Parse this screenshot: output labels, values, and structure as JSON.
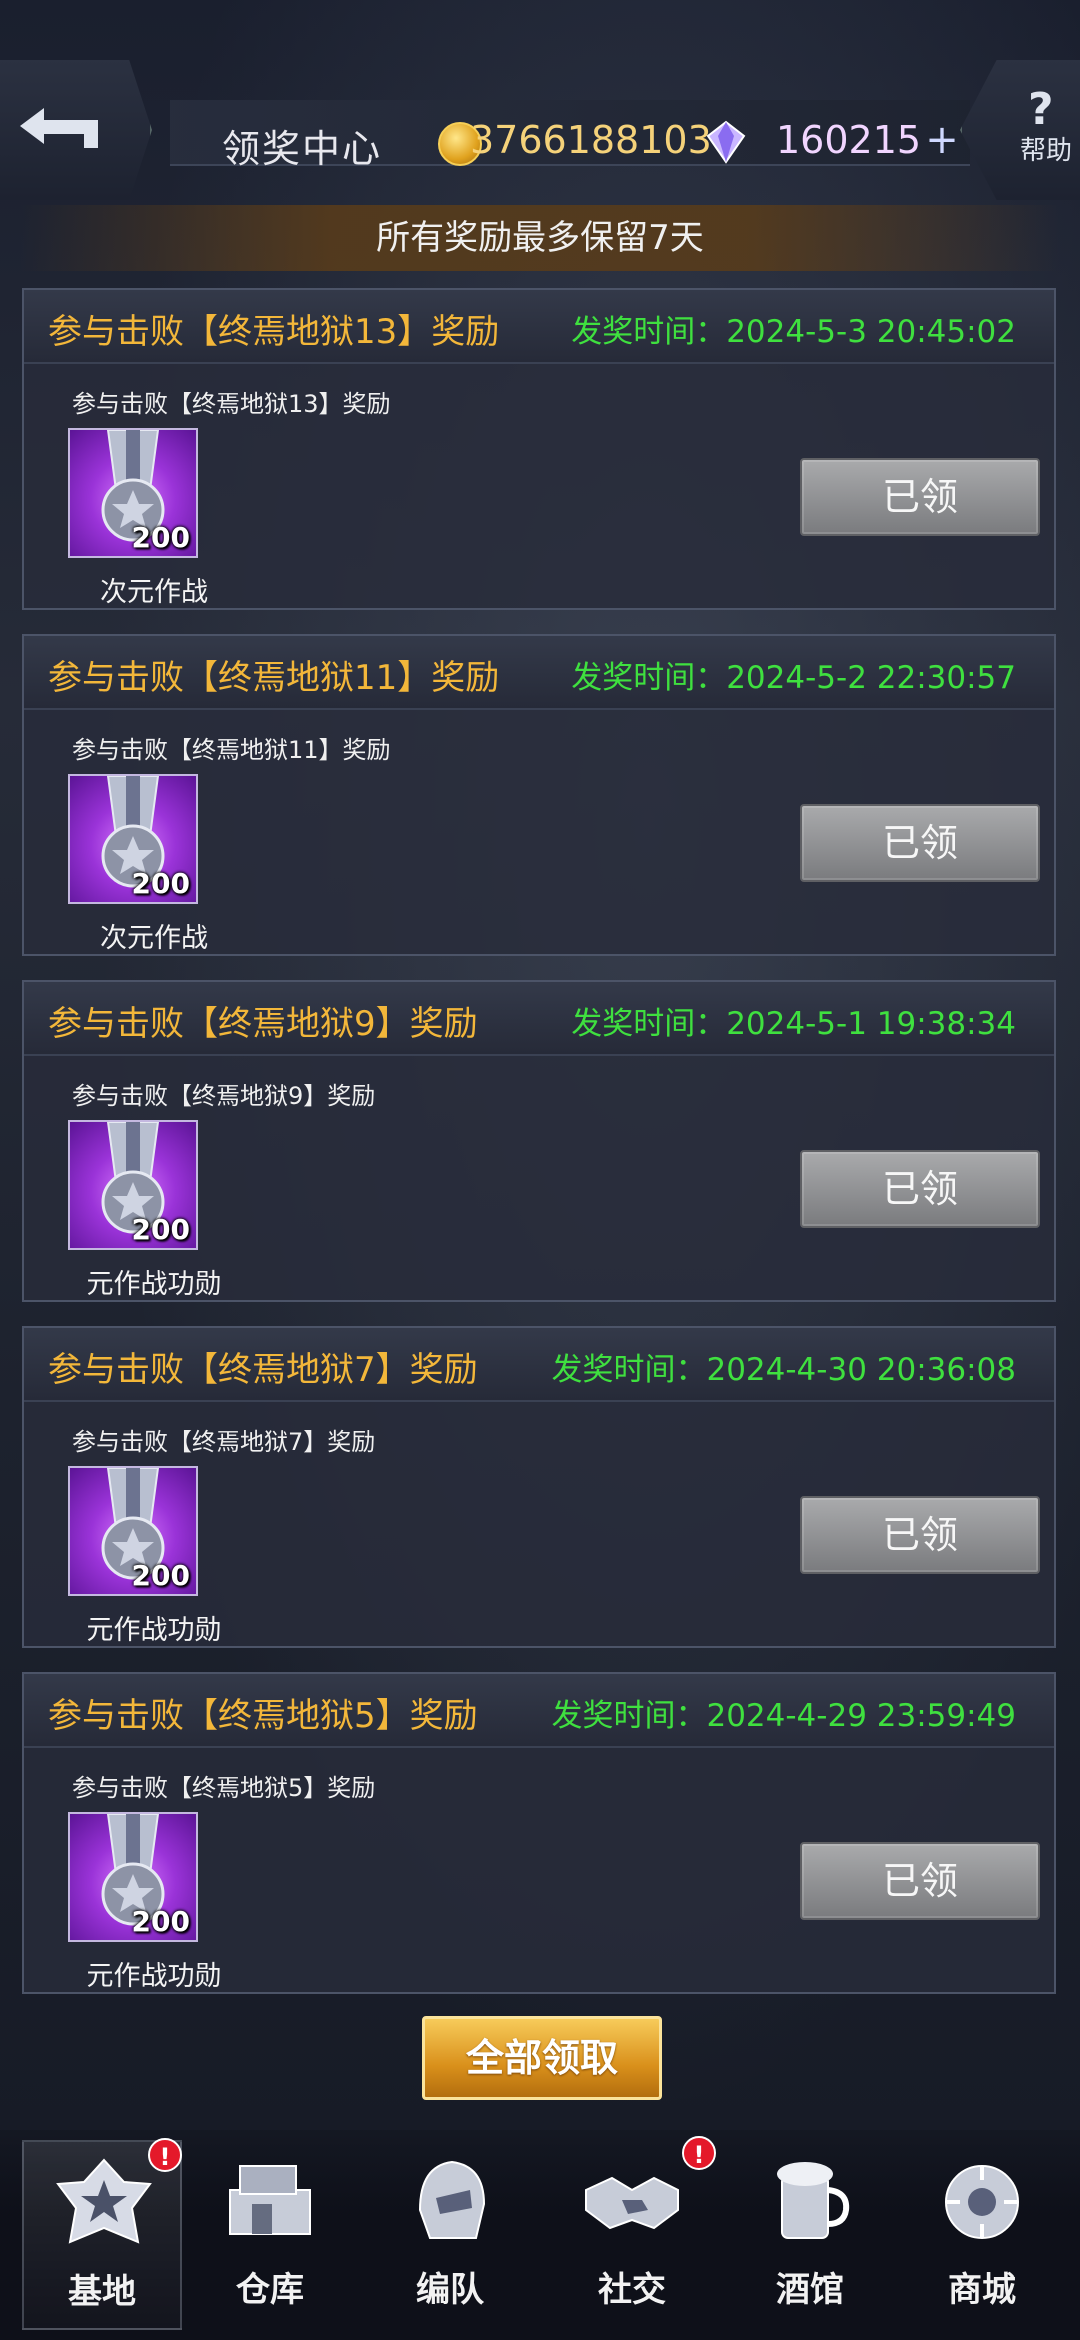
{
  "header": {
    "title": "领奖中心",
    "gold_amount": "3766188103",
    "gem_amount": "160215",
    "help_label": "帮助"
  },
  "notice": "所有奖励最多保留7天",
  "rewards": [
    {
      "title": "参与击败【终焉地狱13】奖励",
      "time": "发奖时间：2024-5-3 20:45:02",
      "sub": "参与击败【终焉地狱13】奖励",
      "qty": "200",
      "item_name": "次元作战",
      "status": "已领"
    },
    {
      "title": "参与击败【终焉地狱11】奖励",
      "time": "发奖时间：2024-5-2 22:30:57",
      "sub": "参与击败【终焉地狱11】奖励",
      "qty": "200",
      "item_name": "次元作战",
      "status": "已领"
    },
    {
      "title": "参与击败【终焉地狱9】奖励",
      "time": "发奖时间：2024-5-1 19:38:34",
      "sub": "参与击败【终焉地狱9】奖励",
      "qty": "200",
      "item_name": "元作战功勋",
      "status": "已领"
    },
    {
      "title": "参与击败【终焉地狱7】奖励",
      "time": "发奖时间：2024-4-30 20:36:08",
      "sub": "参与击败【终焉地狱7】奖励",
      "qty": "200",
      "item_name": "元作战功勋",
      "status": "已领"
    },
    {
      "title": "参与击败【终焉地狱5】奖励",
      "time": "发奖时间：2024-4-29 23:59:49",
      "sub": "参与击败【终焉地狱5】奖励",
      "qty": "200",
      "item_name": "元作战功勋",
      "status": "已领"
    }
  ],
  "claim_all_label": "全部领取",
  "nav": [
    {
      "label": "基地",
      "badge": "!"
    },
    {
      "label": "仓库"
    },
    {
      "label": "编队"
    },
    {
      "label": "社交",
      "badge": "!"
    },
    {
      "label": "酒馆"
    },
    {
      "label": "商城"
    }
  ],
  "colors": {
    "reward_title": "#f3b73a",
    "reward_time": "#3fe03f",
    "claimed_button": "#8f9093",
    "claim_all_button": "#e3a02a",
    "badge": "#e4192a"
  }
}
